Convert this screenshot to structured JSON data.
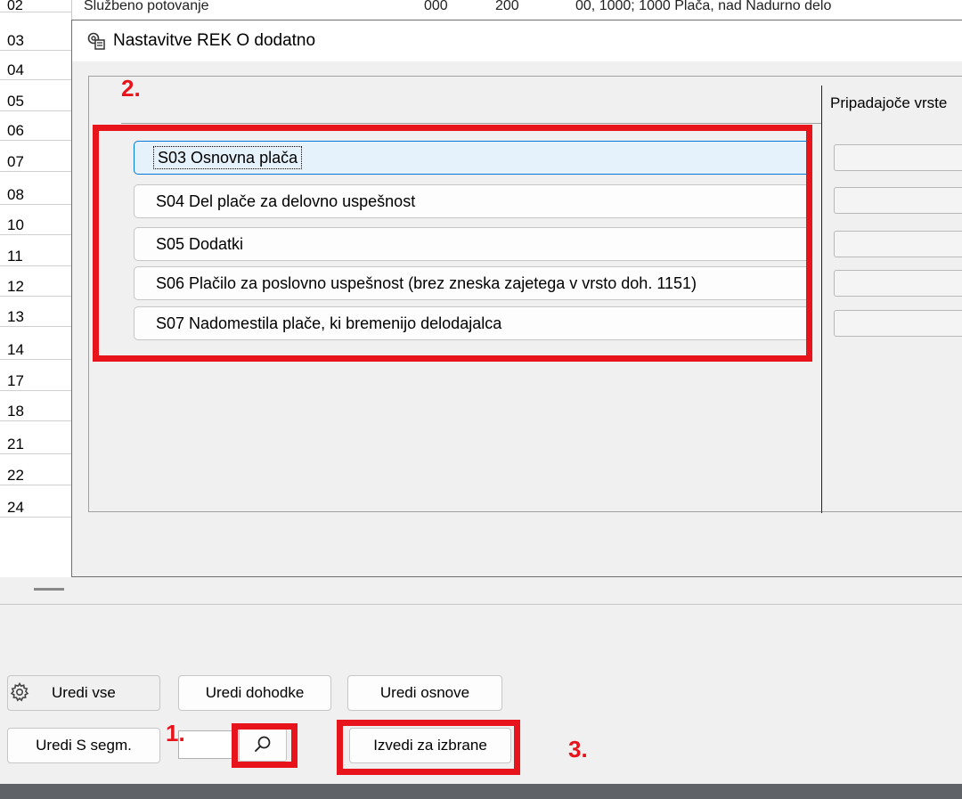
{
  "background": {
    "top_row": {
      "name": "Službeno potovanje",
      "col2": "000",
      "col3": "200",
      "col4": "00, 1000; 1000 Plača, nad Nadurno delo"
    },
    "row_numbers": [
      "03",
      "04",
      "05",
      "06",
      "07",
      "08",
      "10",
      "11",
      "12",
      "13",
      "14",
      "17",
      "18",
      "21",
      "22",
      "24"
    ],
    "first_row_number": "02"
  },
  "dialog": {
    "title": "Nastavitve REK O dodatno",
    "column_header": "Pripadajoče vrste",
    "items": [
      {
        "label": "S03 Osnovna plača"
      },
      {
        "label": "S04 Del plače za delovno uspešnost"
      },
      {
        "label": "S05 Dodatki"
      },
      {
        "label": "S06 Plačilo za poslovno uspešnost (brez zneska zajetega v vrsto doh. 1151)"
      },
      {
        "label": "S07 Nadomestila plače, ki bremenijo delodajalca"
      }
    ]
  },
  "toolbar": {
    "edit_all": "Uredi vse",
    "edit_income": "Uredi dohodke",
    "edit_bases": "Uredi osnove",
    "edit_s_segm": "Uredi S segm.",
    "search_value": "",
    "run_selected": "Izvedi za izbrane"
  },
  "annotations": {
    "step1": "1.",
    "step2": "2.",
    "step3": "3.",
    "color": "#e8141c"
  },
  "icons": {
    "title": "settings-window-icon",
    "gear": "gear-icon",
    "search": "search-icon"
  }
}
